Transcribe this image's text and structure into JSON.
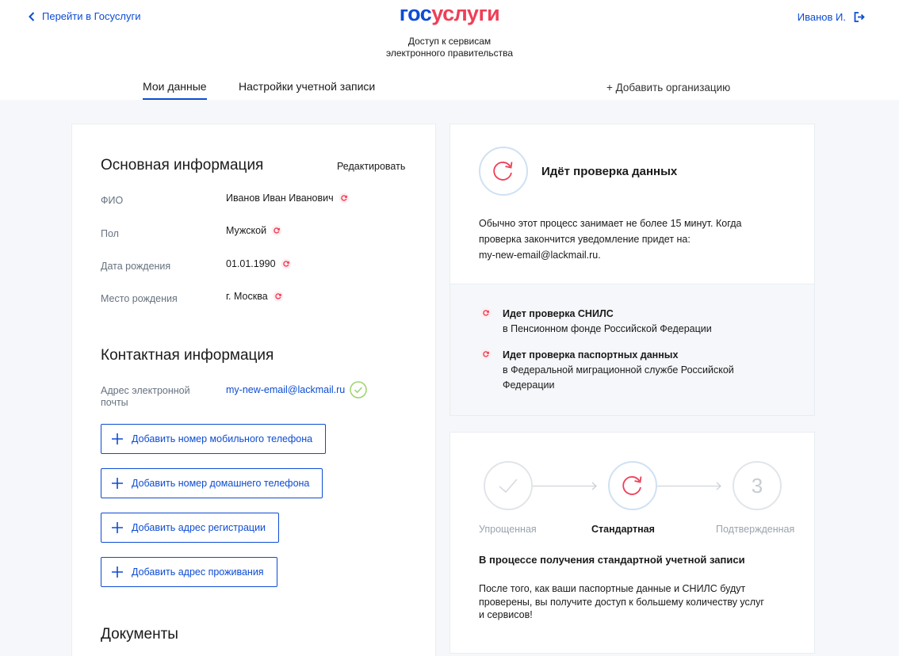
{
  "header": {
    "back_label": "Перейти в Госуслуги",
    "logo_part1": "гос",
    "logo_part2": "услуги",
    "tagline_line1": "Доступ к сервисам",
    "tagline_line2": "электронного правительства",
    "user_name": "Иванов И."
  },
  "tabs": [
    {
      "label": "Мои данные",
      "active": true
    },
    {
      "label": "Настройки учетной записи",
      "active": false
    }
  ],
  "add_org_label": "+ Добавить организацию",
  "basic_info": {
    "title": "Основная информация",
    "edit_label": "Редактировать",
    "fields": [
      {
        "label": "ФИО",
        "value": "Иванов Иван Иванович"
      },
      {
        "label": "Пол",
        "value": "Мужской"
      },
      {
        "label": "Дата рождения",
        "value": "01.01.1990"
      },
      {
        "label": "Место рождения",
        "value": "г. Москва"
      }
    ]
  },
  "contact_info": {
    "title": "Контактная информация",
    "email_label_line1": "Адрес электронной",
    "email_label_line2": "почты",
    "email_value": "my-new-email@lackmail.ru",
    "buttons": [
      "Добавить номер мобильного телефона",
      "Добавить номер домашнего телефона",
      "Добавить адрес регистрации",
      "Добавить адрес проживания"
    ]
  },
  "documents_title": "Документы",
  "checking": {
    "title": "Идёт проверка данных",
    "desc_line1": "Обычно этот процесс занимает не более 15 минут. Когда",
    "desc_line2": "проверка закончится уведомление придет на:",
    "desc_line3": "my-new-email@lackmail.ru.",
    "items": [
      {
        "title": "Идет проверка СНИЛС",
        "line1": "в Пенсионном фонде Российской Федерации",
        "line2": ""
      },
      {
        "title": "Идет проверка паспортных данных",
        "line1": "в Федеральной миграционной службе Российской",
        "line2": "Федерации"
      }
    ]
  },
  "account_levels": {
    "steps": [
      {
        "label": "Упрощенная",
        "state": "done"
      },
      {
        "label": "Стандартная",
        "state": "active"
      },
      {
        "label": "Подтвержденная",
        "state": "pending",
        "number": "3"
      }
    ],
    "process_title": "В процессе получения стандартной учетной записи",
    "desc_line1": "После того, как ваши паспортные данные и СНИЛС будут",
    "desc_line2": "проверены, вы получите доступ к большему количеству услуг",
    "desc_line3": "и сервисов!"
  },
  "colors": {
    "brand_blue": "#0d4cd3",
    "brand_red": "#ee3f58",
    "success_green": "#9dd36b",
    "page_bg": "#f5f7fa"
  }
}
